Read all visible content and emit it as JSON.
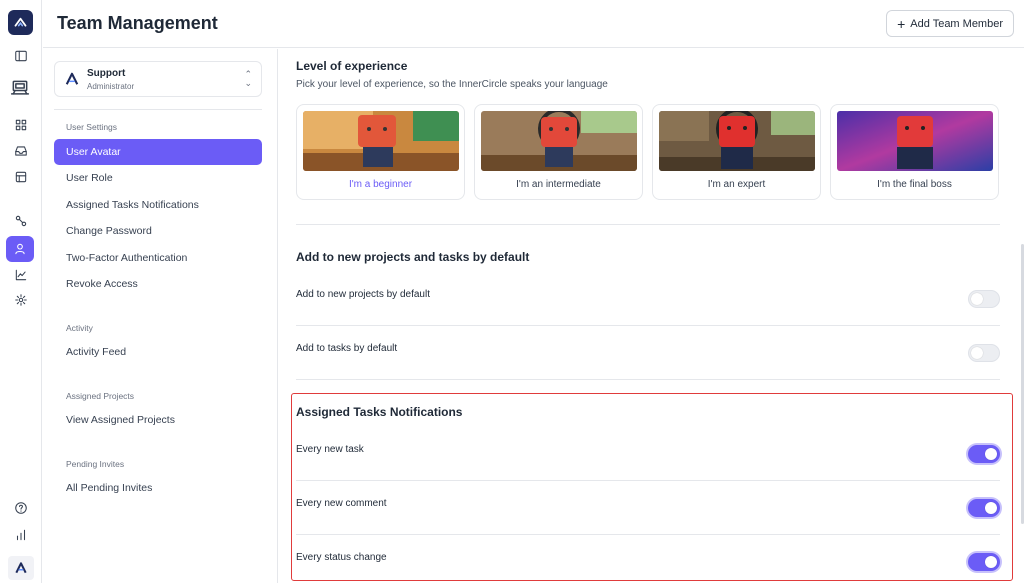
{
  "app": {
    "brand_color": "#6b5cf6"
  },
  "rail": {
    "icons": [
      "app-logo-icon",
      "sidebar-toggle-icon",
      "laptop-icon",
      "dashboard-grid-icon",
      "inbox-icon",
      "calendar-board-icon",
      "workflow-icon",
      "user-icon",
      "analytics-icon",
      "settings-gear-icon",
      "help-icon",
      "bar-chart-icon",
      "bottom-logo-icon"
    ],
    "active": "user-icon"
  },
  "header": {
    "title": "Team Management",
    "add_member_label": "Add Team Member"
  },
  "sidebar": {
    "account": {
      "name": "Support",
      "role": "Administrator"
    },
    "sections": [
      {
        "label": "User Settings",
        "items": [
          "User Avatar",
          "User Role",
          "Assigned Tasks Notifications",
          "Change Password",
          "Two-Factor Authentication",
          "Revoke Access"
        ]
      },
      {
        "label": "Activity",
        "items": [
          "Activity Feed"
        ]
      },
      {
        "label": "Assigned Projects",
        "items": [
          "View Assigned Projects"
        ]
      },
      {
        "label": "Pending Invites",
        "items": [
          "All Pending Invites"
        ]
      }
    ],
    "active_item": "User Avatar"
  },
  "experience": {
    "title": "Level of experience",
    "subtitle": "Pick your level of experience, so the InnerCircle speaks your language",
    "options": [
      {
        "label": "I'm a beginner",
        "selected": true
      },
      {
        "label": "I'm an intermediate",
        "selected": false
      },
      {
        "label": "I'm an expert",
        "selected": false
      },
      {
        "label": "I'm the final boss",
        "selected": false
      }
    ]
  },
  "defaults": {
    "title": "Add to new projects and tasks by default",
    "rows": [
      {
        "label": "Add to new projects by default",
        "on": false
      },
      {
        "label": "Add to tasks by default",
        "on": false
      }
    ]
  },
  "notifications": {
    "title": "Assigned Tasks Notifications",
    "rows": [
      {
        "label": "Every new task",
        "on": true
      },
      {
        "label": "Every new comment",
        "on": true
      },
      {
        "label": "Every status change",
        "on": true
      }
    ]
  }
}
